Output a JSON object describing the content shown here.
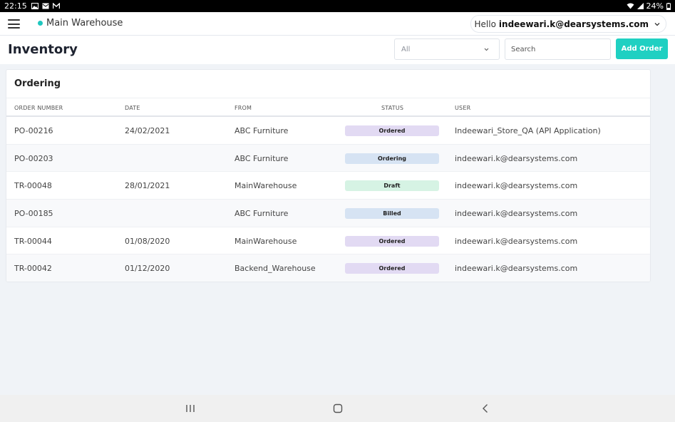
{
  "status_bar": {
    "time": "22:15",
    "battery": "24%"
  },
  "topbar": {
    "location": "Main Warehouse",
    "greeting": "Hello",
    "user": "indeewari.k@dearsystems.com"
  },
  "header": {
    "title": "Inventory",
    "filter_value": "All",
    "search_placeholder": "Search",
    "add_button": "Add Order"
  },
  "card": {
    "title": "Ordering",
    "columns": [
      "ORDER NUMBER",
      "DATE",
      "FROM",
      "STATUS",
      "USER"
    ],
    "rows": [
      {
        "order": "PO-00216",
        "date": "24/02/2021",
        "from": "ABC Furniture",
        "status": "Ordered",
        "user": "Indeewari_Store_QA (API Application)"
      },
      {
        "order": "PO-00203",
        "date": "",
        "from": "ABC Furniture",
        "status": "Ordering",
        "user": "indeewari.k@dearsystems.com"
      },
      {
        "order": "TR-00048",
        "date": "28/01/2021",
        "from": "MainWarehouse",
        "status": "Draft",
        "user": "indeewari.k@dearsystems.com"
      },
      {
        "order": "PO-00185",
        "date": "",
        "from": "ABC Furniture",
        "status": "Billed",
        "user": "indeewari.k@dearsystems.com"
      },
      {
        "order": "TR-00044",
        "date": "01/08/2020",
        "from": "MainWarehouse",
        "status": "Ordered",
        "user": "indeewari.k@dearsystems.com"
      },
      {
        "order": "TR-00042",
        "date": "01/12/2020",
        "from": "Backend_Warehouse",
        "status": "Ordered",
        "user": "indeewari.k@dearsystems.com"
      }
    ]
  },
  "colors": {
    "accent": "#1fd0c2",
    "location_dot": "#1fc7bf",
    "status_ordered": "#e2daf3",
    "status_ordering": "#d6e3f3",
    "status_draft": "#d6f3e4",
    "status_billed": "#d6e3f3"
  },
  "icons": {
    "menu": "hamburger-icon",
    "dropdown": "chevron-down-icon",
    "nav_recents": "recents-icon",
    "nav_home": "home-icon",
    "nav_back": "back-icon"
  }
}
